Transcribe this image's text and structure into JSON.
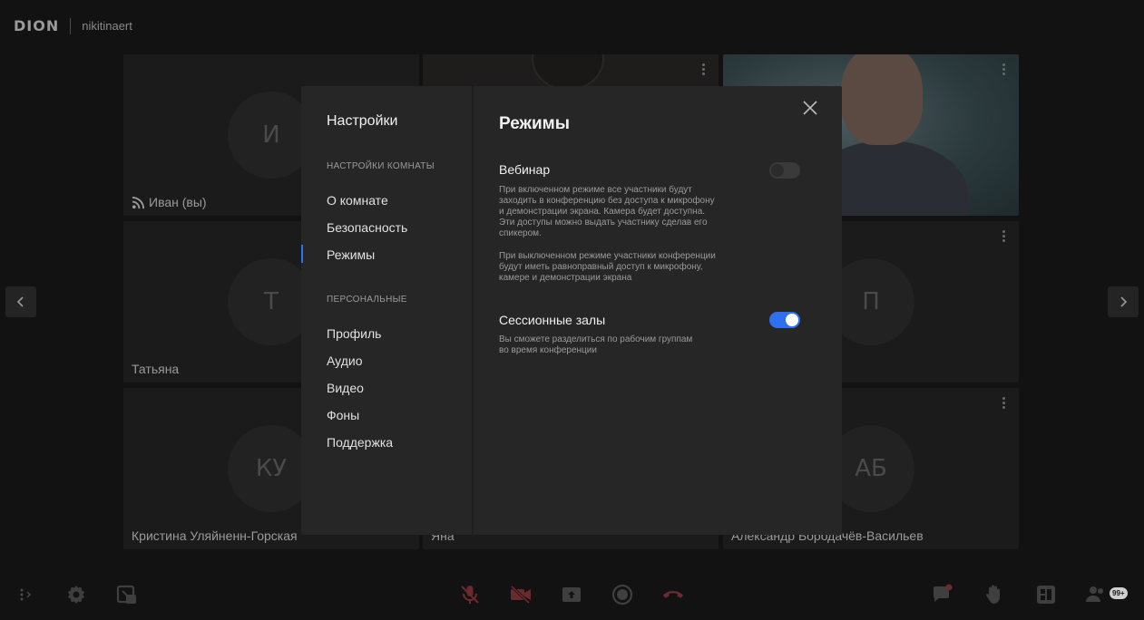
{
  "brand": {
    "logo": "DION",
    "user": "nikitinaert"
  },
  "participants": [
    {
      "initials": "И",
      "name": "Иван (вы)"
    },
    {
      "initials": "",
      "name": ""
    },
    {
      "initials": "",
      "name": ""
    },
    {
      "initials": "Т",
      "name": "Татьяна"
    },
    {
      "initials": "П",
      "name": ""
    },
    {
      "initials": "КУ",
      "name": "Кристина Уляйненн-Горская"
    },
    {
      "initials": "",
      "name": "Яна"
    },
    {
      "initials": "АБ",
      "name": "Александр Бородачёв-Васильев"
    }
  ],
  "settings": {
    "title": "Настройки",
    "room_section": "НАСТРОЙКИ КОМНАТЫ",
    "room_items": [
      "О комнате",
      "Безопасность",
      "Режимы"
    ],
    "personal_section": "ПЕРСОНАЛЬНЫЕ",
    "personal_items": [
      "Профиль",
      "Аудио",
      "Видео",
      "Фоны",
      "Поддержка"
    ],
    "active_item": "Режимы"
  },
  "modes": {
    "title": "Режимы",
    "webinar": {
      "label": "Вебинар",
      "enabled": false,
      "desc_on": "При включенном режиме все участники будут\nзаходить в конференцию без доступа к микрофону\nи демонстрации экрана. Камера будет доступна.\nЭти доступы можно выдать участнику сделав его\nспикером.",
      "desc_off": "При выключенном режиме участники конференции\nбудут иметь равноправный доступ к микрофону,\nкамере и демонстрации экрана"
    },
    "breakout": {
      "label": "Сессионные залы",
      "enabled": true,
      "desc": "Вы сможете разделиться по рабочим группам\nво время конференции"
    }
  },
  "toolbar": {
    "participants_badge": "99+"
  },
  "colors": {
    "accent": "#2f6ff0",
    "danger": "#b8343a",
    "background": "#121212",
    "panel": "#262626"
  }
}
